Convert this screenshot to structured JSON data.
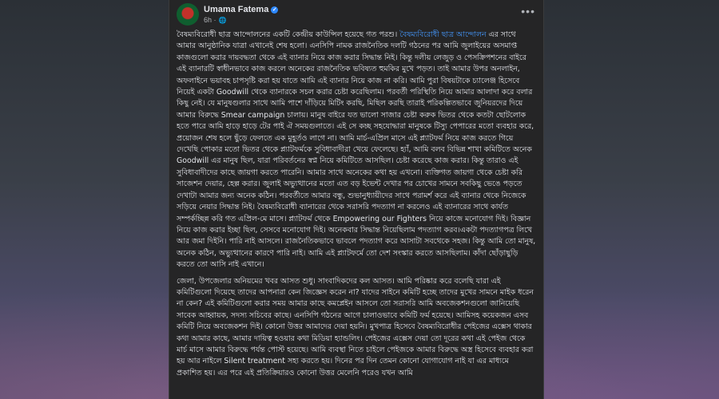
{
  "post": {
    "author": "Umama Fatema",
    "time": "6h",
    "paragraph1_intro": "বৈষম্যবিরোধী ছাত্র আন্দোলনের একটি কেন্দ্রীয় কাউন্সিল হয়েছে গত পরশু। ",
    "paragraph1_link": "বৈষম্যবিরোধী ছাত্র আন্দোলন",
    "paragraph1_rest": " এর সাথে আমার আনুষ্ঠানিক যাত্রা এখানেই শেষ হলো। এনসিপি নামক রাজনৈতিক দলটি গঠনের পর আমি জুলাইয়ের অসমাপ্ত কাজগুলো করার দায়বদ্ধতা থেকে এই ব্যানার নিয়ে কাজ করার সিদ্ধান্ত নিই। কিন্তু দলীয় লেজুড় ও পেসক্রিপশনের বাইরে এই ব্যানারটি স্বাধীনভাবে কাজ করলে অনেকের রাজনৈতিক ভবিষ্যত হুমকির মুখে পড়ত। তাই আমার উপর অনলাইন, অফলাইনে ভয়াবহ চাপসৃষ্টি করা হয় যাতে আমি এই ব্যানার নিয়ে কাজ না করি। আমি পুরা বিষয়টাকে চ্যালেঞ্জ হিসেবে নিয়েই একটা Goodwill থেকে ব্যানারকে সচল করার চেষ্টা করেছিলাম। পরবর্তী পরিস্থিতি নিয়ে আমার আলাদা করে বলার কিছু নেই। যে মানুষগুলার সাথে আমি পাশে দাঁড়িয়ে মিটিং করছি, মিছিল করছি তারাই পরিকল্পিতভাবে জুনিয়রদের দিয়ে আমার বিরুদ্ধে Smear campaign চালায়। মানুষ বাইরে যত ভালো সাজার চেষ্টা করুক ভিতর থেকে কতটা ছোটলোক হতে পারে আমি হাড়ে হাড়ে টের পাই ঐ সময়গুলাতে। এই সে কচ্ছ সহযোদ্ধারা মানুষকে টিস্যু পেপারের মতো ব্যবহার করে, প্রয়োজন শেষ হলে ছুঁড়ে ফেলতে এক মুহূর্তও লাগে না। আমি মার্চ-এপ্রিল মাসে এই প্ল্যাটফর্ম নিয়ে কাজ করতে গিয়ে দেখেছি পোকার মতো ভিতর থেকে প্ল্যাটফর্মকে সুবিধাবাদীরা খেয়ে ফেলেছে। হ্যাঁ, আমি বলব বিভিন্ন শাখা কমিটিতে অনেক Goodwill এর মানুষ ছিল, যারা পরিবর্তনের স্বপ্ন নিয়ে কমিটিতে আসছিল। চেষ্টা করেছে কাজ করার। কিন্তু তারাও এই সুবিধাবাদীদের কাছে জায়গা করতে পারেনি। আমার সাথে অনেকের কথা হয় এখনো। ব্যক্তিগত জায়গা থেকে চেষ্টা করি সাজেশন দেয়ার, হেল্প করার। জুলাই অভ্যুত্থানের মতো এত বড় ইভেন্ট দেখার পর চোখের সামনে সবকিছু ভেঙে পড়তে দেখাটা আমার জন্য অনেক কঠিন। পরবর্তীতে আমার বন্ধু, শুভানুধ্যায়ীদের সাথে পরামর্শ করে এই ব্যানার থেকে নিজেকে সড়িয়ে নেয়ার সিদ্ধান্ত নিই। বৈষম্যবিরোধী ব্যানারের থেকে সরাসরি পদত্যাগ না করলেও এই ব্যানারের সাথে কার্যত সম্পর্কচ্ছিন্ন করি গত এপ্রিল-মে মাসে। প্ল্যাটফর্ম থেকে Empowering our Fighters নিয়ে কাজে মনোযোগ দিই। বিজ্ঞান নিয়ে কাজ করার ইচ্ছা ছিল, সেসবে মনোযোগ দিই। অনেকবার সিদ্ধান্ত নিয়েছিলাম পদত্যাগ করব।একটা পদত্যাগপত্র লিখে আর জমা দিইনি। পারি নাই আসলে। রাজনৈতিকভাবে ভাবলে পদত্যাগ করে আসাটা সবথেকে সহজ। কিন্তু আমি তো মানুষ, অনেক কঠিন, অভ্যুত্থানের কারণে পারি নাই। আমি এই প্ল্যাটফর্মে তো দেশ সংস্কার করতে আসছিলাম। কাঁদা ছোঁড়াছুড়ি করতে তো আসি নাই এখানে।",
    "paragraph2": "জেলা, উপজেলার অনিয়মের খবর আসত শুধু। সাংবাদিকদের কল আসত। আমি পরিষ্কার করে বলেছি যারা এই কমিটিগুলো দিয়েছে তাদের আপনারা কেন জিজ্ঞেস করেন না? যাদের সাইনে কমিটি হচ্ছে তাদের মুখের সামনে মাইক ধরেন না কেন? এই কমিটিগুলো করার সময় আমার কাছে কমপ্লেইন আসলে তো সরাসরি আমি অবজেকশনগুলো জানিয়েছি সাবেক আহ্বায়ক, সদস্য সচিবের কাছে। এনসিপি গঠনের আগে চালাওভাবে কমিটি ফর্ম হয়েছে। আমিসহ কয়েকজন এসব কমিটি নিয়ে অবজেকশন দিই। কোনো উত্তর আমাদের দেয়া হয়নি। মুখপাত্র হিসেবে বৈষম্যবিরোধীর পেইজের এক্সেস থাকার কথা আমার কাছে, আমার দায়িত্ব হওয়ার কথা মিডিয়া হ্যান্ডলিং। পেইজের এক্সেস দেয়া তো দূরের কথা এই পেইজ থেকে মার্চ মাসে আমার বিরুদ্ধে পর্যন্ত পোস্ট হয়েছে। আমি ব্যবস্থা নিতে চাইলে পেইজকে আমার বিরুদ্ধে অস্ত্র হিসেবে ব্যবহার করা হয় আর নাইলে Silent treatment সহ্য করতে হয়। দিনের পর দিন তেমন কোনো যোগাযোগ নাই যা এর মাধ্যমে প্রকাশিত হয়। এর পরে এই প্রতিক্রিয়ারও কোনো উত্তর মেলেনি পরেও যখন আমি"
  }
}
